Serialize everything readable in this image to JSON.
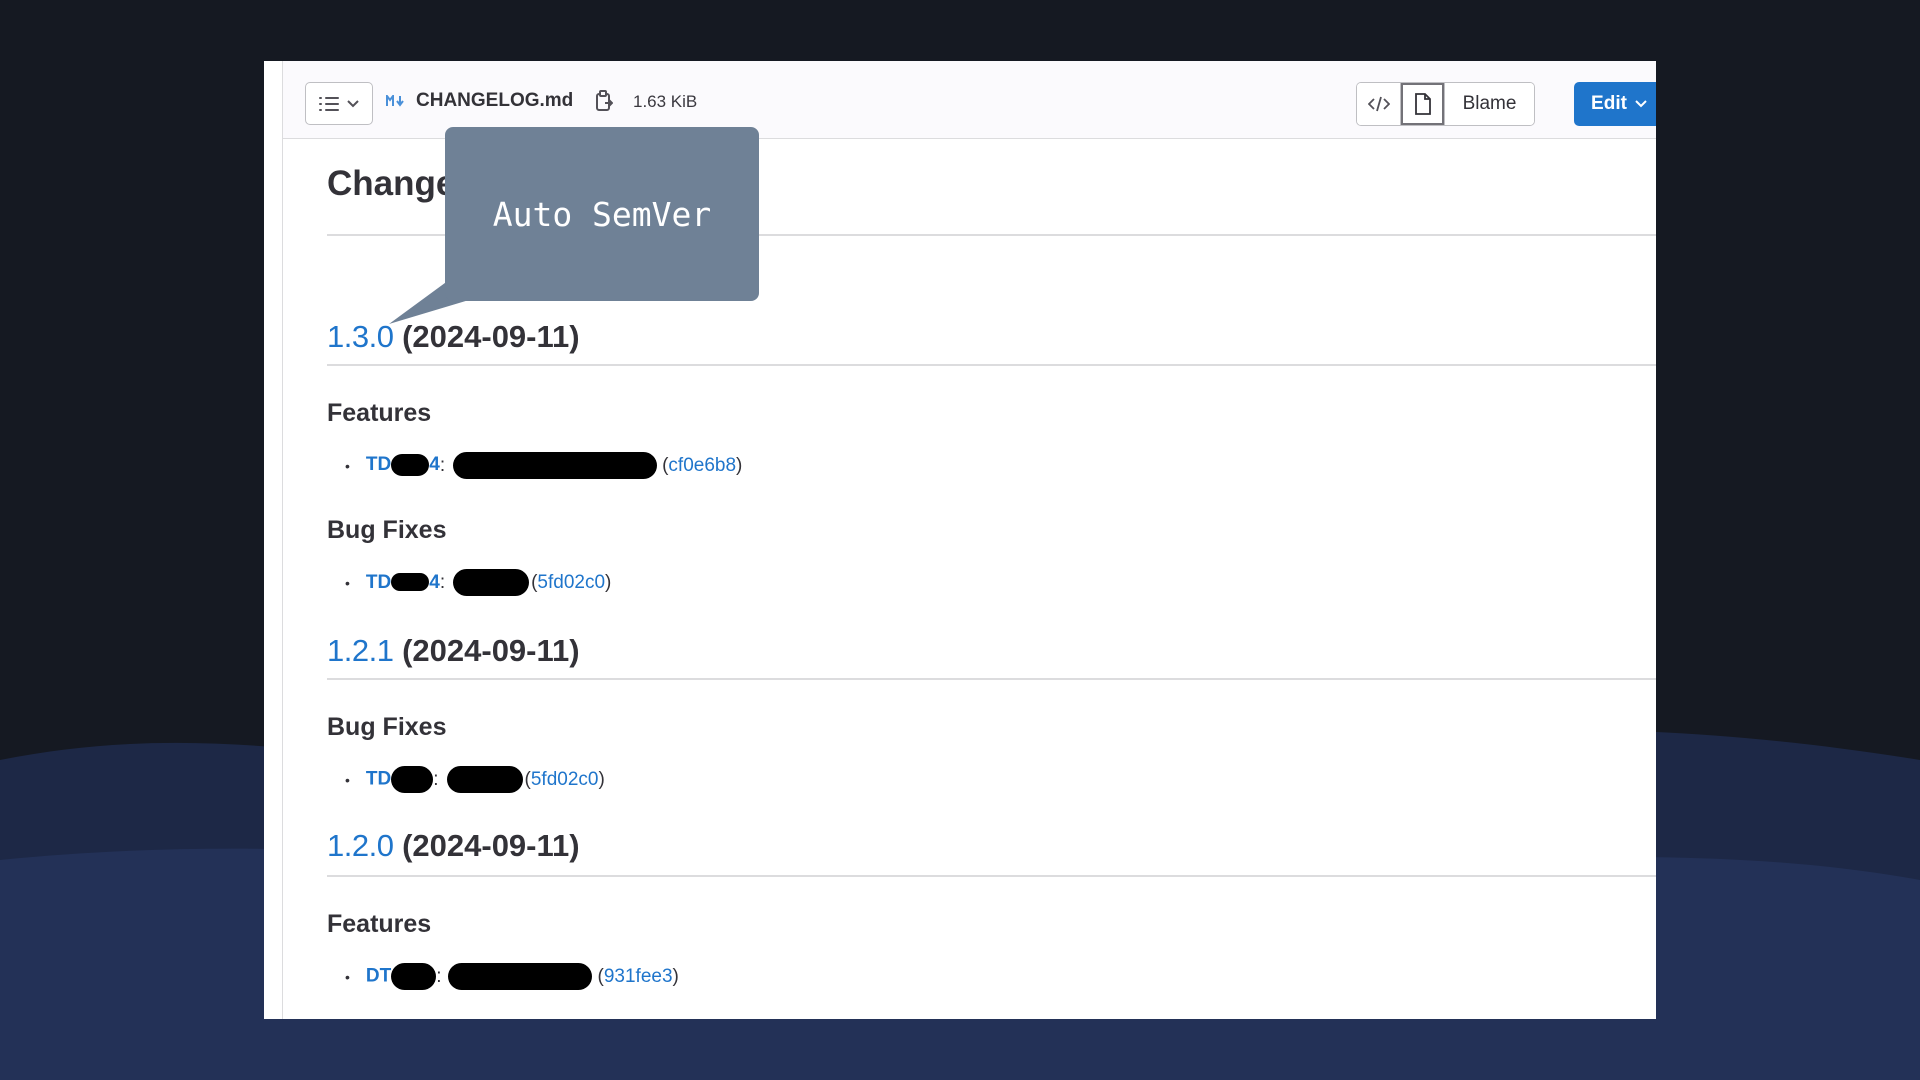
{
  "colors": {
    "background": "#151922",
    "wave": "#1f2b4a",
    "link": "#1f75cb",
    "edit_button": "#1f75cb",
    "callout": "#6f8196"
  },
  "toolbar": {
    "toc_icon": "list-icon",
    "md_badge": "M↓",
    "file_name": "CHANGELOG.md",
    "file_size": "1.63 KiB",
    "code_view_icon": "code-icon",
    "rendered_view_icon": "file-icon",
    "blame_label": "Blame",
    "edit_label": "Edit"
  },
  "callout": {
    "text": "Auto SemVer"
  },
  "document": {
    "title": "Change",
    "releases": [
      {
        "version": "1.3.0",
        "date": "(2024-09-11)",
        "sections": [
          {
            "heading": "Features",
            "items": [
              {
                "issue_prefix": "TD",
                "issue_suffix": "4",
                "hash": "cf0e6b8"
              }
            ]
          },
          {
            "heading": "Bug Fixes",
            "items": [
              {
                "issue_prefix": "TD",
                "issue_suffix": "4",
                "hash": "5fd02c0"
              }
            ]
          }
        ]
      },
      {
        "version": "1.2.1",
        "date": "(2024-09-11)",
        "sections": [
          {
            "heading": "Bug Fixes",
            "items": [
              {
                "issue_prefix": "TD",
                "issue_suffix": "",
                "hash": "5fd02c0"
              }
            ]
          }
        ]
      },
      {
        "version": "1.2.0",
        "date": "(2024-09-11)",
        "sections": [
          {
            "heading": "Features",
            "items": [
              {
                "issue_prefix": "DT",
                "issue_suffix": "",
                "hash": "931fee3"
              }
            ]
          }
        ]
      }
    ]
  },
  "punct": {
    "colon": ":",
    "open": "(",
    "close": ")",
    "bullet": "•"
  }
}
